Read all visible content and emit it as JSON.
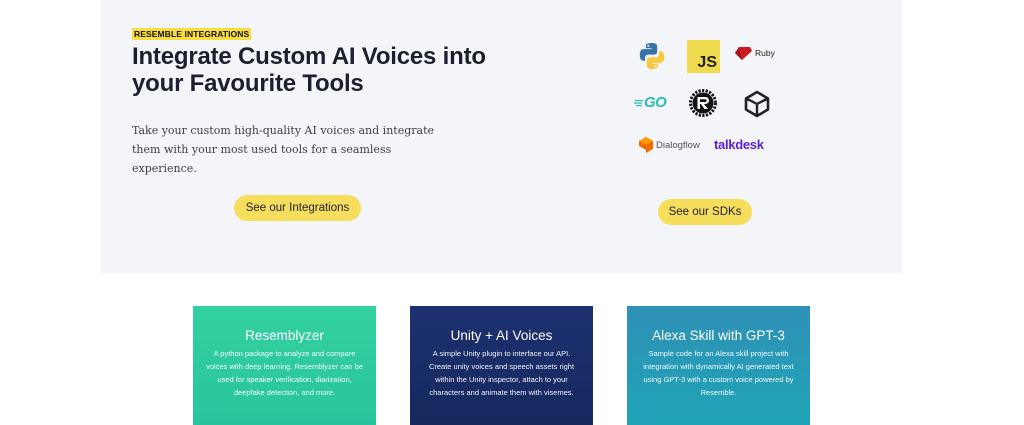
{
  "hero": {
    "badge": "RESEMBLE INTEGRATIONS",
    "headline": "Integrate Custom AI Voices into your Favourite Tools",
    "body": "Take your custom high-quality AI voices and integrate them with your most used tools for a seamless experience.",
    "integrations_button": "See our Integrations",
    "sdks_button": "See our SDKs"
  },
  "logos": {
    "js": "JS",
    "ruby": "Ruby",
    "go": "GO",
    "dialogflow": "Dialogflow",
    "talkdesk": "talkdesk"
  },
  "cards": [
    {
      "title": "Resemblyzer",
      "description": "A python package to analyze and compare voices with deep learning. Resemblyzer can be used for speaker verification, diarization, deepfake detection, and more."
    },
    {
      "title": "Unity + AI Voices",
      "description": "A simple Unity plugin to interface our API. Create unity voices and speech assets right within the Unity inspector, attach to your characters and animate them with visemes."
    },
    {
      "title": "Alexa Skill with GPT-3",
      "description": "Sample code for an Alexa skill project with integration with dynamically AI generated text using GPT-3 with a custom voice powered by Resemble."
    }
  ],
  "colors": {
    "accent_yellow": "#f6de5c",
    "card_green": "#2ecb9e",
    "card_navy": "#1a2d67",
    "card_teal": "#2799b6"
  }
}
